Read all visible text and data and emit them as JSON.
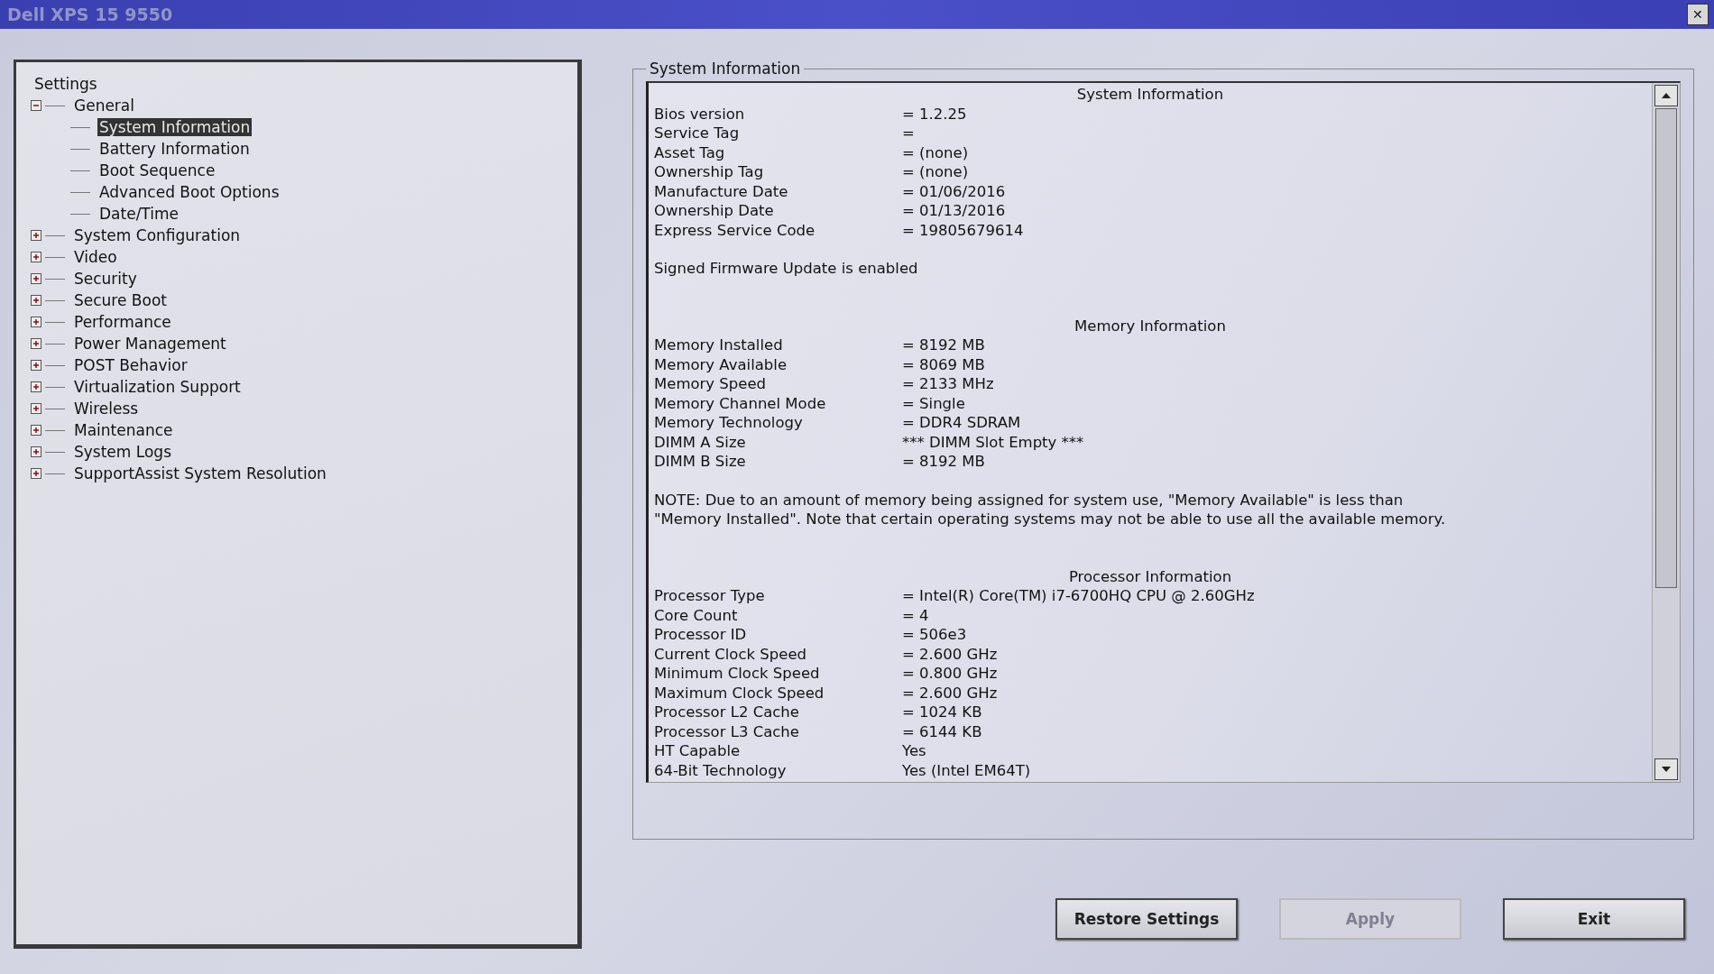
{
  "window": {
    "title": "Dell XPS 15 9550",
    "close": "✕"
  },
  "tree": {
    "root": "Settings",
    "items": [
      {
        "label": "General",
        "expanded": true,
        "selected": false,
        "children": [
          {
            "label": "System Information",
            "selected": true
          },
          {
            "label": "Battery Information",
            "selected": false
          },
          {
            "label": "Boot Sequence",
            "selected": false
          },
          {
            "label": "Advanced Boot Options",
            "selected": false
          },
          {
            "label": "Date/Time",
            "selected": false
          }
        ]
      },
      {
        "label": "System Configuration",
        "expanded": false,
        "selected": false
      },
      {
        "label": "Video",
        "expanded": false,
        "selected": false
      },
      {
        "label": "Security",
        "expanded": false,
        "selected": false
      },
      {
        "label": "Secure Boot",
        "expanded": false,
        "selected": false
      },
      {
        "label": "Performance",
        "expanded": false,
        "selected": false
      },
      {
        "label": "Power Management",
        "expanded": false,
        "selected": false
      },
      {
        "label": "POST Behavior",
        "expanded": false,
        "selected": false
      },
      {
        "label": "Virtualization Support",
        "expanded": false,
        "selected": false
      },
      {
        "label": "Wireless",
        "expanded": false,
        "selected": false
      },
      {
        "label": "Maintenance",
        "expanded": false,
        "selected": false
      },
      {
        "label": "System Logs",
        "expanded": false,
        "selected": false
      },
      {
        "label": "SupportAssist System Resolution",
        "expanded": false,
        "selected": false
      }
    ]
  },
  "group": {
    "title": "System Information",
    "sections": [
      {
        "heading": "System Information",
        "rows": [
          {
            "label": "Bios version",
            "value": "= 1.2.25"
          },
          {
            "label": "Service Tag",
            "value": "="
          },
          {
            "label": "Asset Tag",
            "value": "= (none)"
          },
          {
            "label": "Ownership Tag",
            "value": "= (none)"
          },
          {
            "label": "Manufacture Date",
            "value": "= 01/06/2016"
          },
          {
            "label": "Ownership Date",
            "value": "= 01/13/2016"
          },
          {
            "label": "Express Service Code",
            "value": "= 19805679614"
          }
        ],
        "note": "Signed Firmware Update is enabled"
      },
      {
        "heading": "Memory Information",
        "rows": [
          {
            "label": "Memory Installed",
            "value": "= 8192 MB"
          },
          {
            "label": "Memory Available",
            "value": "= 8069 MB"
          },
          {
            "label": "Memory Speed",
            "value": "= 2133 MHz"
          },
          {
            "label": "Memory Channel Mode",
            "value": "= Single"
          },
          {
            "label": "Memory Technology",
            "value": "= DDR4 SDRAM"
          },
          {
            "label": "DIMM A Size",
            "value": "*** DIMM Slot Empty ***"
          },
          {
            "label": "DIMM B Size",
            "value": "= 8192 MB"
          }
        ],
        "note": "NOTE: Due to an amount of memory being assigned for system use, \"Memory Available\" is less than \"Memory Installed\". Note that certain operating systems may not be able to use all the available memory."
      },
      {
        "heading": "Processor Information",
        "rows": [
          {
            "label": "Processor Type",
            "value": "= Intel(R) Core(TM) i7-6700HQ CPU @ 2.60GHz"
          },
          {
            "label": "Core Count",
            "value": "= 4"
          },
          {
            "label": "Processor ID",
            "value": "= 506e3"
          },
          {
            "label": "Current Clock Speed",
            "value": "= 2.600 GHz"
          },
          {
            "label": "Minimum Clock Speed",
            "value": "= 0.800 GHz"
          },
          {
            "label": "Maximum Clock Speed",
            "value": "= 2.600 GHz"
          },
          {
            "label": "Processor L2 Cache",
            "value": "= 1024 KB"
          },
          {
            "label": "Processor L3 Cache",
            "value": "= 6144 KB"
          },
          {
            "label": "HT Capable",
            "value": "Yes"
          },
          {
            "label": "64-Bit Technology",
            "value": "Yes (Intel EM64T)"
          }
        ]
      }
    ]
  },
  "buttons": [
    {
      "label": "Restore Settings",
      "disabled": false
    },
    {
      "label": "Apply",
      "disabled": true
    },
    {
      "label": "Exit",
      "disabled": false
    }
  ]
}
